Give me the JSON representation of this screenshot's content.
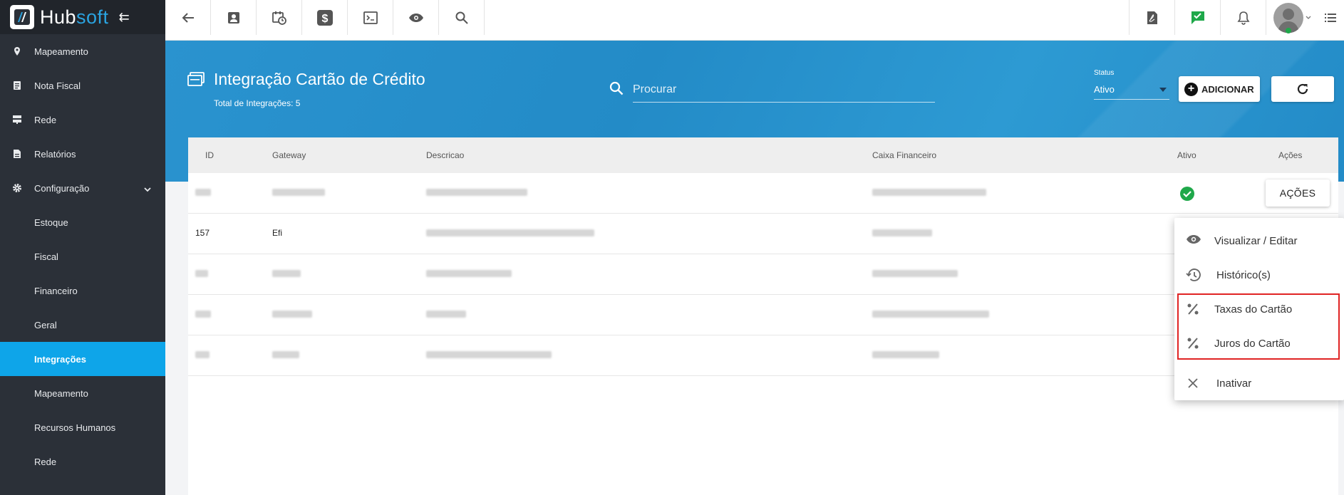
{
  "brand": {
    "name_a": "Hub",
    "name_b": "soft"
  },
  "sidebar": {
    "items": [
      {
        "label": "Mapeamento",
        "icon": "map-pin-icon"
      },
      {
        "label": "Nota Fiscal",
        "icon": "document-icon"
      },
      {
        "label": "Rede",
        "icon": "server-icon"
      },
      {
        "label": "Relatórios",
        "icon": "report-icon"
      },
      {
        "label": "Configuração",
        "icon": "gear-icon"
      },
      {
        "label": "Estoque"
      },
      {
        "label": "Fiscal"
      },
      {
        "label": "Financeiro"
      },
      {
        "label": "Geral"
      },
      {
        "label": "Integrações",
        "active": true
      },
      {
        "label": "Mapeamento"
      },
      {
        "label": "Recursos Humanos"
      },
      {
        "label": "Rede"
      }
    ]
  },
  "header": {
    "title": "Integração Cartão de Crédito",
    "subtitle": "Total de Integrações: 5",
    "search_placeholder": "Procurar",
    "status_label": "Status",
    "status_value": "Ativo",
    "add_label": "ADICIONAR"
  },
  "table": {
    "columns": [
      "ID",
      "Gateway",
      "Descricao",
      "Caixa Financeiro",
      "Ativo",
      "Ações"
    ],
    "row_action_label": "AÇÕES",
    "visible_row": {
      "id": "157",
      "gateway": "Efi"
    }
  },
  "menu": {
    "items": [
      {
        "label": "Visualizar / Editar",
        "icon": "eye-icon"
      },
      {
        "label": "Histórico(s)",
        "icon": "history-icon"
      },
      {
        "label": "Taxas do Cartão",
        "icon": "percent-icon"
      },
      {
        "label": "Juros do Cartão",
        "icon": "percent-icon"
      },
      {
        "label": "Inativar",
        "icon": "close-icon"
      }
    ]
  },
  "colors": {
    "accent": "#0ea5e9",
    "band": "#238bc7",
    "sidebar": "#2b3038",
    "highlight": "#e02424",
    "success": "#1fa84a"
  }
}
